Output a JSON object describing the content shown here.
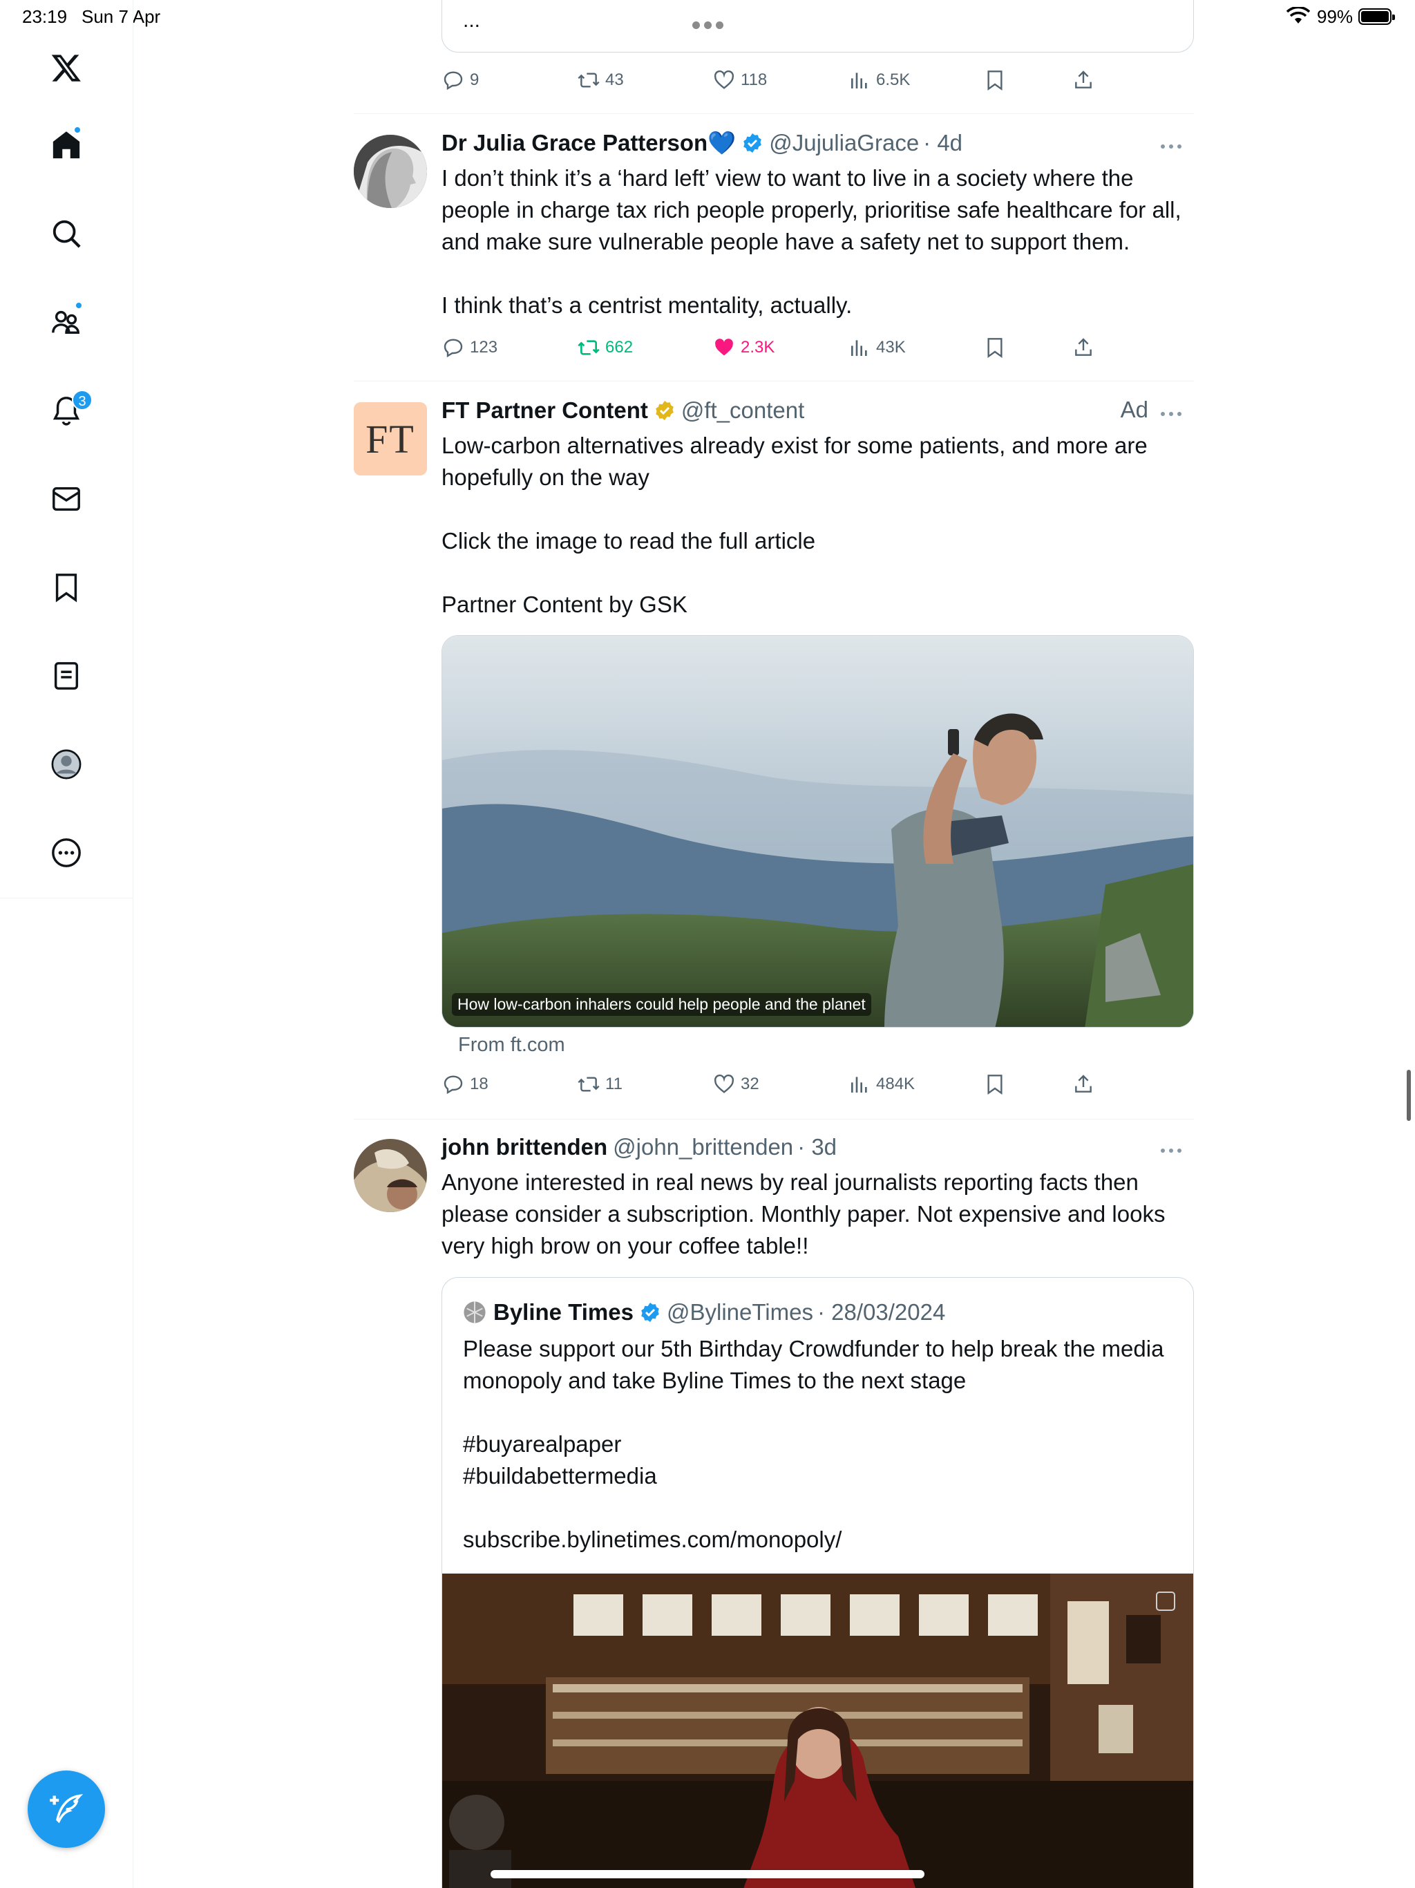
{
  "status_bar": {
    "time": "23:19",
    "date": "Sun 7 Apr",
    "battery": "99%"
  },
  "sidebar": {
    "notifications_badge": "3",
    "items": [
      "Home",
      "Explore",
      "Communities",
      "Notifications",
      "Messages",
      "Bookmarks",
      "Lists",
      "Profile",
      "More"
    ]
  },
  "colors": {
    "accent": "#1d9bf0",
    "retweet_green": "#00ba7c",
    "like_pink": "#f91880",
    "muted": "#536471"
  },
  "tweet_top": {
    "ellipsis": "...",
    "stats": {
      "replies": "9",
      "reposts": "43",
      "likes": "118",
      "views": "6.5K"
    }
  },
  "tweet_julia": {
    "name": "Dr Julia Grace Patterson💙",
    "handle": "@JujuliaGrace",
    "time": "· 4d",
    "text": "I don’t think it’s a ‘hard left’ view to want to live in a society where the people in charge tax rich people properly, prioritise safe healthcare for all, and make sure vulnerable people have a safety net to support them.\n\nI think that’s a centrist mentality, actually.",
    "stats": {
      "replies": "123",
      "reposts": "662",
      "likes": "2.3K",
      "views": "43K"
    }
  },
  "tweet_ft": {
    "avatar_text": "FT",
    "name": "FT Partner Content",
    "handle": "@ft_content",
    "ad_label": "Ad",
    "text": "Low-carbon alternatives already exist for some patients, and more are hopefully on the way\n\nClick the image to read the full article\n\nPartner Content by GSK",
    "card_caption": "How low-carbon inhalers could help people and the planet",
    "card_source": "From ft.com",
    "stats": {
      "replies": "18",
      "reposts": "11",
      "likes": "32",
      "views": "484K"
    }
  },
  "tweet_john": {
    "name": "john brittenden",
    "handle": "@john_brittenden",
    "time": "· 3d",
    "text": "Anyone interested in real news by real journalists reporting facts then please consider a subscription. Monthly paper. Not expensive and looks very high brow on your coffee table!!",
    "quote": {
      "name": "Byline Times",
      "handle": "@BylineTimes",
      "date": "· 28/03/2024",
      "text": "Please support our 5th Birthday Crowdfunder to help break the media monopoly and take Byline Times to the next stage\n\n#buyarealpaper\n#buildabettermedia\n\nsubscribe.bylinetimes.com/monopoly/"
    }
  }
}
